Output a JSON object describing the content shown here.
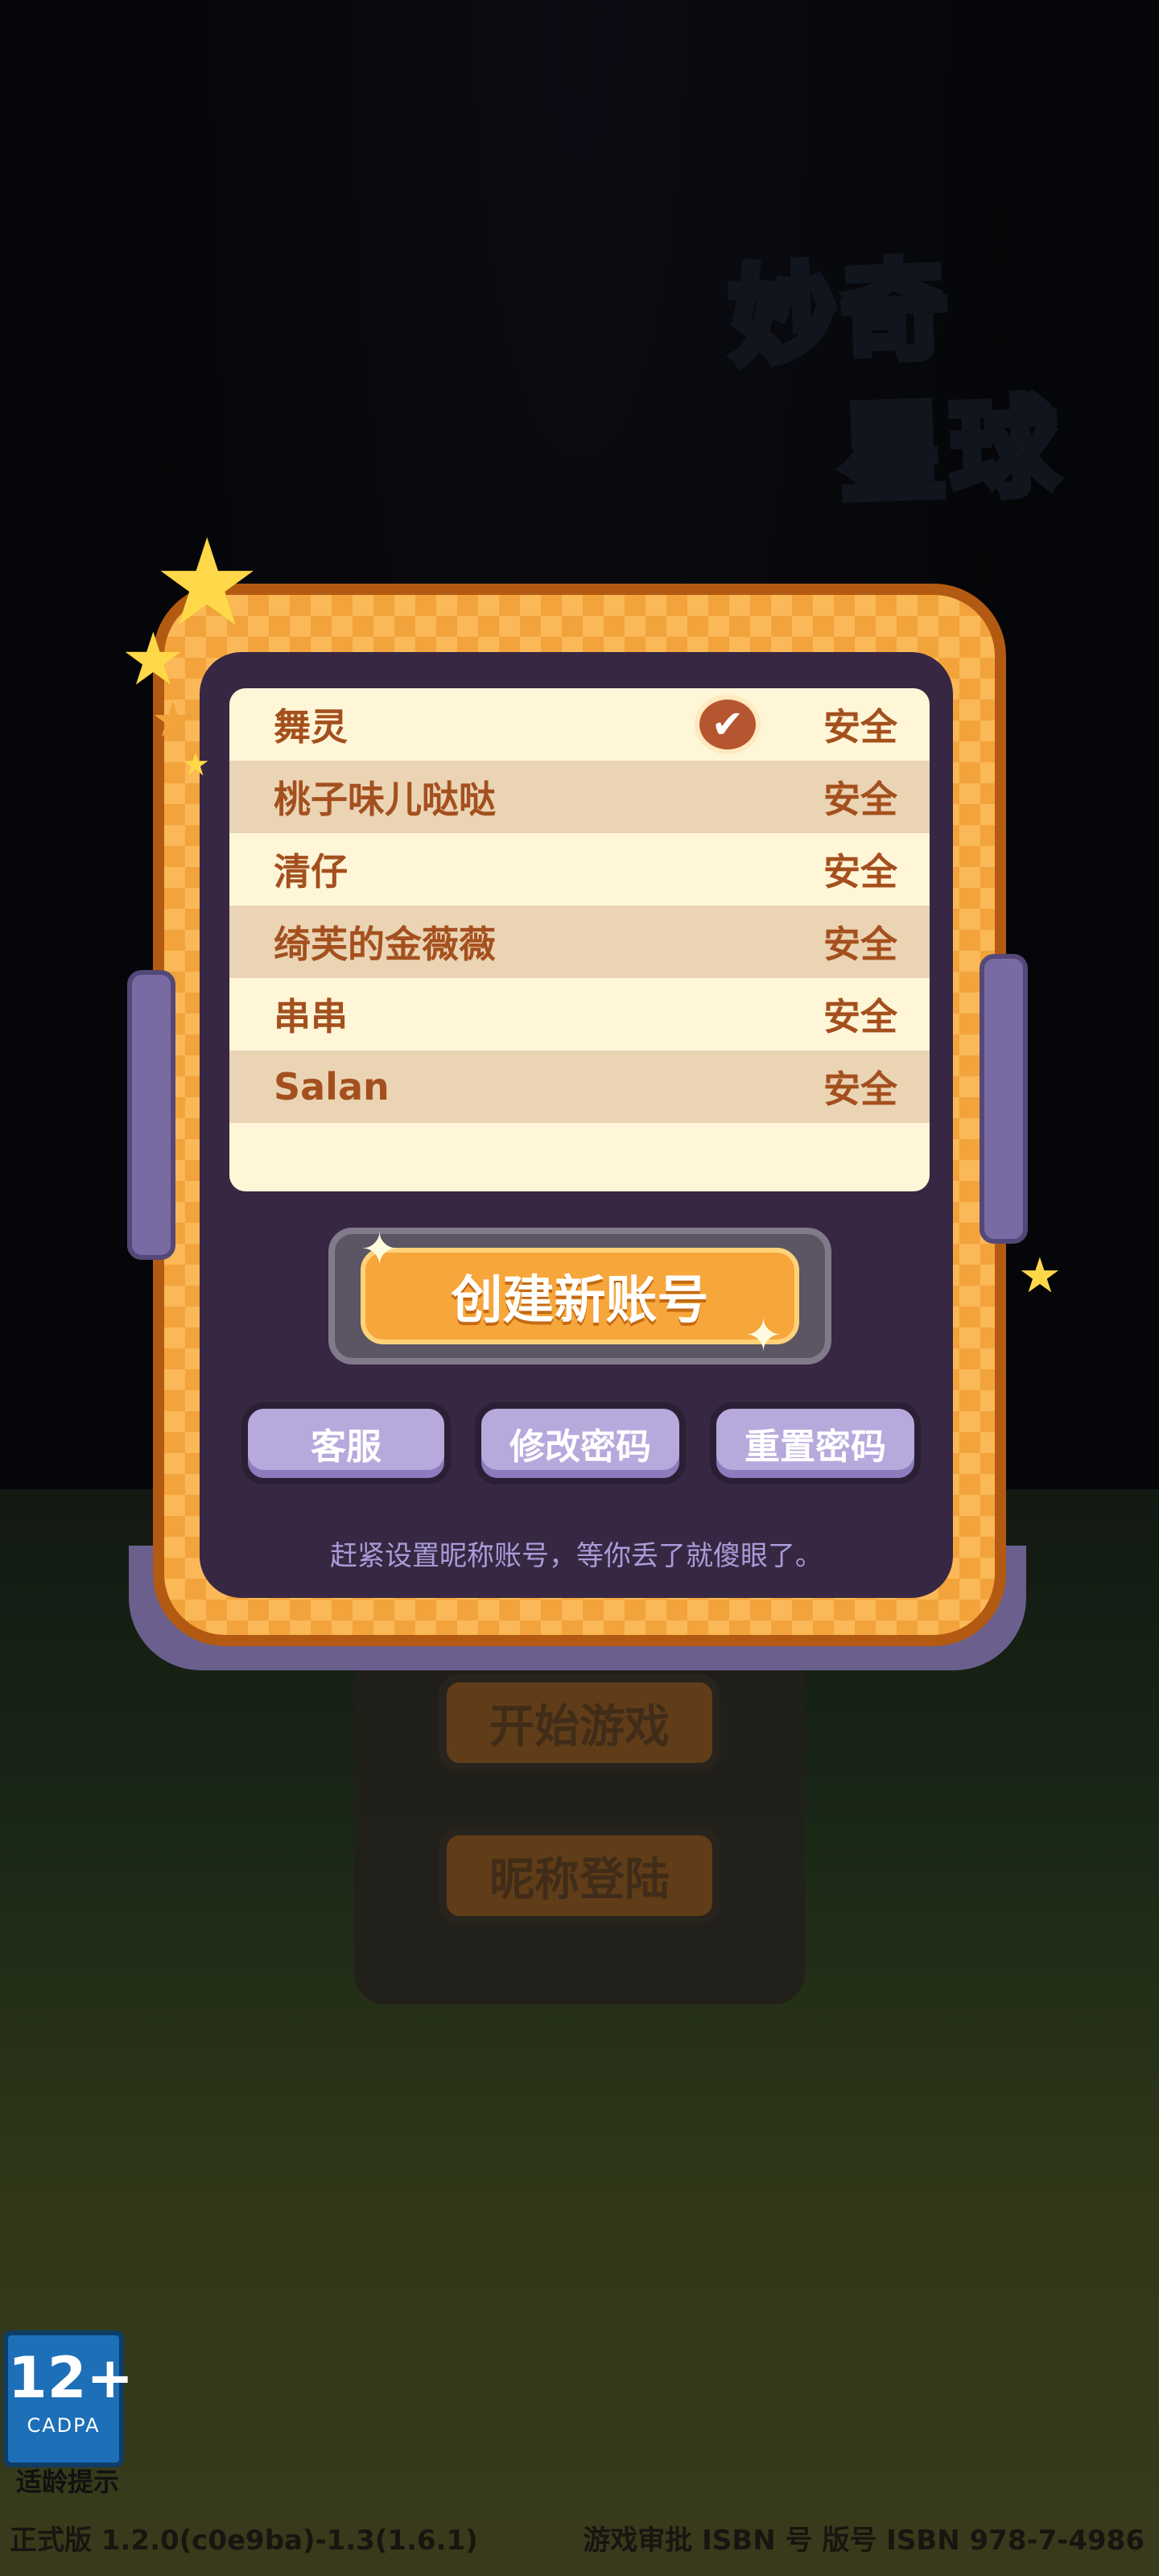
{
  "logo": {
    "line1": "妙奇",
    "line2": "星球"
  },
  "background_menu": {
    "start_game": "开始游戏",
    "nickname_login": "昵称登陆"
  },
  "accounts": [
    {
      "name": "舞灵",
      "status": "安全",
      "selected": true
    },
    {
      "name": "桃子味儿哒哒",
      "status": "安全",
      "selected": false
    },
    {
      "name": "清仔",
      "status": "安全",
      "selected": false
    },
    {
      "name": "绮芙的金薇薇",
      "status": "安全",
      "selected": false
    },
    {
      "name": "串串",
      "status": "安全",
      "selected": false
    },
    {
      "name": "Salan",
      "status": "安全",
      "selected": false
    }
  ],
  "buttons": {
    "create_account": "创建新账号",
    "customer_service": "客服",
    "change_password": "修改密码",
    "reset_password": "重置密码"
  },
  "tip": "赶紧设置昵称账号，等你丢了就傻眼了。",
  "age_rating": {
    "age": "12+",
    "org": "CADPA",
    "label": "适龄提示"
  },
  "footer": {
    "version": "正式版 1.2.0(c0e9ba)-1.3(1.6.1)",
    "license": "游戏审批 ISBN 号 版号 ISBN 978-7-4986"
  },
  "colors": {
    "frame_orange": "#f3a33b",
    "panel_purple": "#372742",
    "list_cream": "#fff6d8",
    "text_brown": "#a4501e",
    "button_lavender": "#b7a9dc"
  },
  "icons": {
    "selected_check": "check-circle-icon",
    "decor_star": "star-icon",
    "sparkle": "sparkle-icon"
  }
}
